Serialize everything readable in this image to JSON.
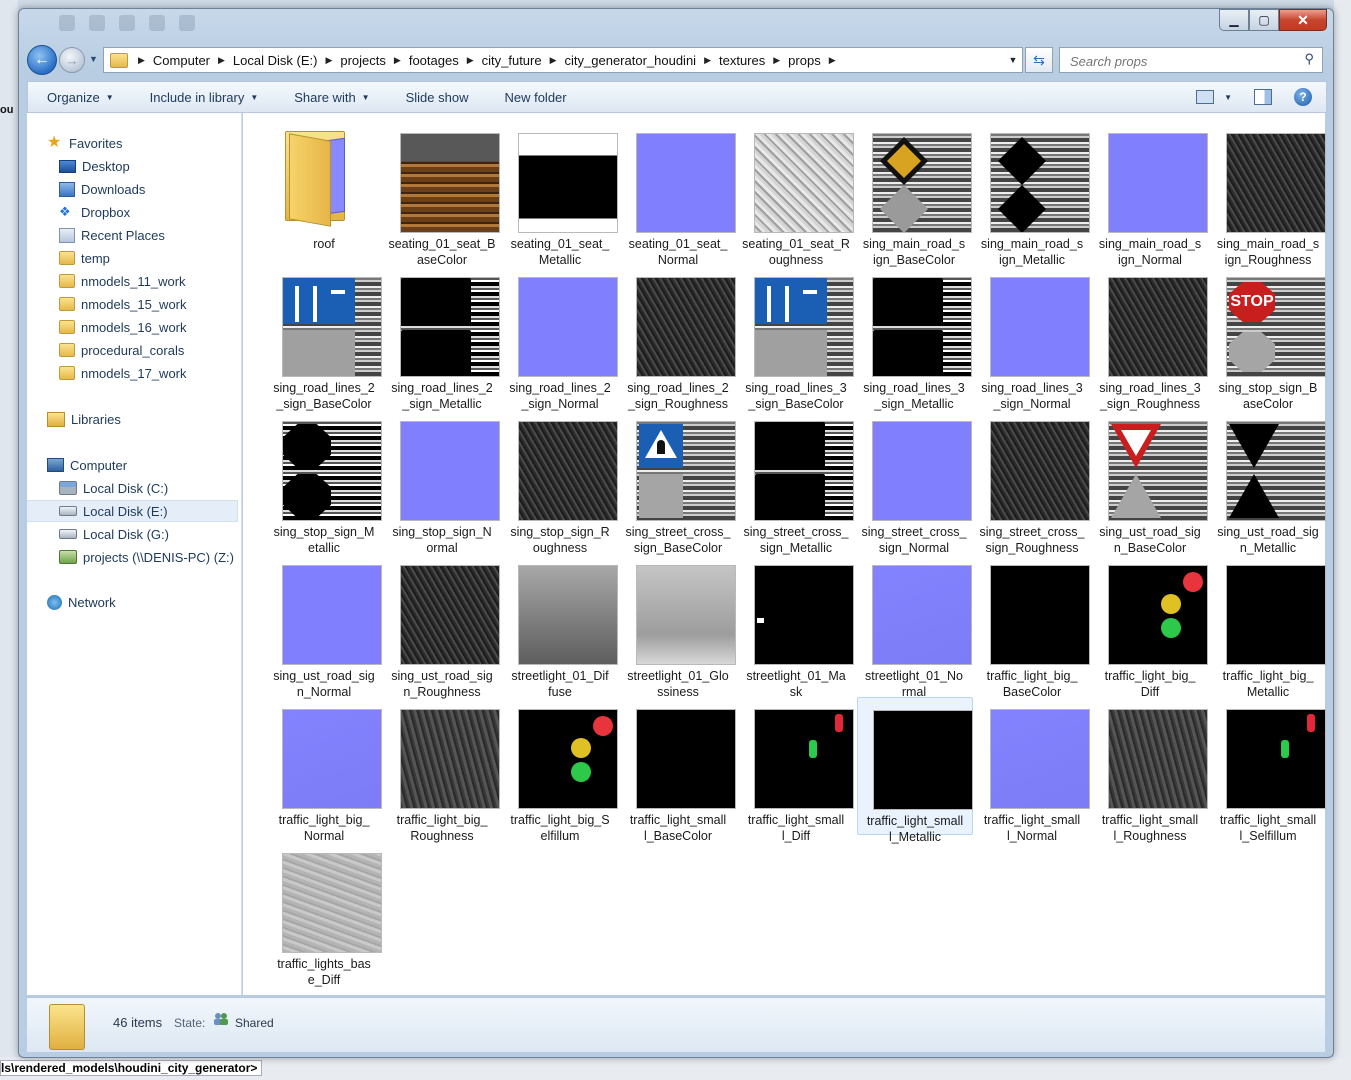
{
  "window": {
    "address": {
      "crumbs": [
        "Computer",
        "Local Disk (E:)",
        "projects",
        "footages",
        "city_future",
        "city_generator_houdini",
        "textures",
        "props"
      ]
    },
    "search_placeholder": "Search props",
    "close_glyph": "✕",
    "minimize_glyph": "▁",
    "maximize_glyph": "▢"
  },
  "toolbar": {
    "organize": "Organize",
    "include_in_library": "Include in library",
    "share_with": "Share with",
    "slide_show": "Slide show",
    "new_folder": "New folder"
  },
  "nav": {
    "favorites": "Favorites",
    "favorites_items": [
      "Desktop",
      "Downloads",
      "Dropbox",
      "Recent Places",
      "temp",
      "nmodels_11_work",
      "nmodels_15_work",
      "nmodels_16_work",
      "procedural_corals",
      "nmodels_17_work"
    ],
    "libraries": "Libraries",
    "computer": "Computer",
    "computer_items": [
      "Local Disk (C:)",
      "Local Disk (E:)",
      "Local Disk (G:)",
      "projects (\\\\DENIS-PC) (Z:)"
    ],
    "selected": "Local Disk (E:)",
    "network": "Network"
  },
  "files": [
    {
      "label": "roof",
      "kind": "folder"
    },
    {
      "label": "seating_01_seat_B\naseColor",
      "kind": "t-wood2"
    },
    {
      "label": "seating_01_seat_\nMetallic",
      "kind": "t-metal1"
    },
    {
      "label": "seating_01_seat_\nNormal",
      "kind": "t-blue"
    },
    {
      "label": "seating_01_seat_R\noughness",
      "kind": "t-stone"
    },
    {
      "label": "sing_main_road_s\nign_BaseColor",
      "kind": "diamond"
    },
    {
      "label": "sing_main_road_s\nign_Metallic",
      "kind": "diamond-black"
    },
    {
      "label": "sing_main_road_s\nign_Normal",
      "kind": "t-blue"
    },
    {
      "label": "sing_main_road_s\nign_Roughness",
      "kind": "t-dark"
    },
    {
      "label": "sing_road_lines_2\n_sign_BaseColor",
      "kind": "lanes"
    },
    {
      "label": "sing_road_lines_2\n_sign_Metallic",
      "kind": "black-streaks"
    },
    {
      "label": "sing_road_lines_2\n_sign_Normal",
      "kind": "t-blue"
    },
    {
      "label": "sing_road_lines_2\n_sign_Roughness",
      "kind": "t-dark"
    },
    {
      "label": "sing_road_lines_3\n_sign_BaseColor",
      "kind": "lanes"
    },
    {
      "label": "sing_road_lines_3\n_sign_Metallic",
      "kind": "black-streaks"
    },
    {
      "label": "sing_road_lines_3\n_sign_Normal",
      "kind": "t-blue"
    },
    {
      "label": "sing_road_lines_3\n_sign_Roughness",
      "kind": "t-dark"
    },
    {
      "label": "sing_stop_sign_B\naseColor",
      "kind": "stop",
      "text": "STOP"
    },
    {
      "label": "sing_stop_sign_M\netallic",
      "kind": "octagon-black"
    },
    {
      "label": "sing_stop_sign_N\normal",
      "kind": "t-blue"
    },
    {
      "label": "sing_stop_sign_R\noughness",
      "kind": "t-dark"
    },
    {
      "label": "sing_street_cross_\nsign_BaseColor",
      "kind": "crossing"
    },
    {
      "label": "sing_street_cross_\nsign_Metallic",
      "kind": "black-streaks"
    },
    {
      "label": "sing_street_cross_\nsign_Normal",
      "kind": "t-blue"
    },
    {
      "label": "sing_street_cross_\nsign_Roughness",
      "kind": "t-dark"
    },
    {
      "label": "sing_ust_road_sig\nn_BaseColor",
      "kind": "yield"
    },
    {
      "label": "sing_ust_road_sig\nn_Metallic",
      "kind": "yield-black"
    },
    {
      "label": "sing_ust_road_sig\nn_Normal",
      "kind": "t-blue"
    },
    {
      "label": "sing_ust_road_sig\nn_Roughness",
      "kind": "t-dark"
    },
    {
      "label": "streetlight_01_Dif\nfuse",
      "kind": "t-fog"
    },
    {
      "label": "streetlight_01_Glo\nssiness",
      "kind": "t-fog2"
    },
    {
      "label": "streetlight_01_Ma\nsk",
      "kind": "mask"
    },
    {
      "label": "streetlight_01_No\nrmal",
      "kind": "t-blue2"
    },
    {
      "label": "traffic_light_big_\nBaseColor",
      "kind": "t-black"
    },
    {
      "label": "traffic_light_big_\nDiff",
      "kind": "tl-big"
    },
    {
      "label": "traffic_light_big_\nMetallic",
      "kind": "t-black"
    },
    {
      "label": "traffic_light_big_\nNormal",
      "kind": "t-blue2"
    },
    {
      "label": "traffic_light_big_\nRoughness",
      "kind": "t-dark2"
    },
    {
      "label": "traffic_light_big_S\nelfillum",
      "kind": "tl-big"
    },
    {
      "label": "traffic_light_small\nl_BaseColor",
      "kind": "t-black"
    },
    {
      "label": "traffic_light_small\nl_Diff",
      "kind": "ped"
    },
    {
      "label": "traffic_light_small\nl_Metallic",
      "kind": "t-black",
      "selected": true
    },
    {
      "label": "traffic_light_small\nl_Normal",
      "kind": "t-blue2"
    },
    {
      "label": "traffic_light_small\nl_Roughness",
      "kind": "t-dark2"
    },
    {
      "label": "traffic_light_small\nl_Selfillum",
      "kind": "ped"
    },
    {
      "label": "traffic_lights_bas\ne_Diff",
      "kind": "t-gray"
    }
  ],
  "details": {
    "count": "46 items",
    "state_label": "State:",
    "state_value": "Shared"
  },
  "background": {
    "left_text": "ou",
    "bottom_path": "ls\\rendered_models\\houdini_city_generator>"
  }
}
